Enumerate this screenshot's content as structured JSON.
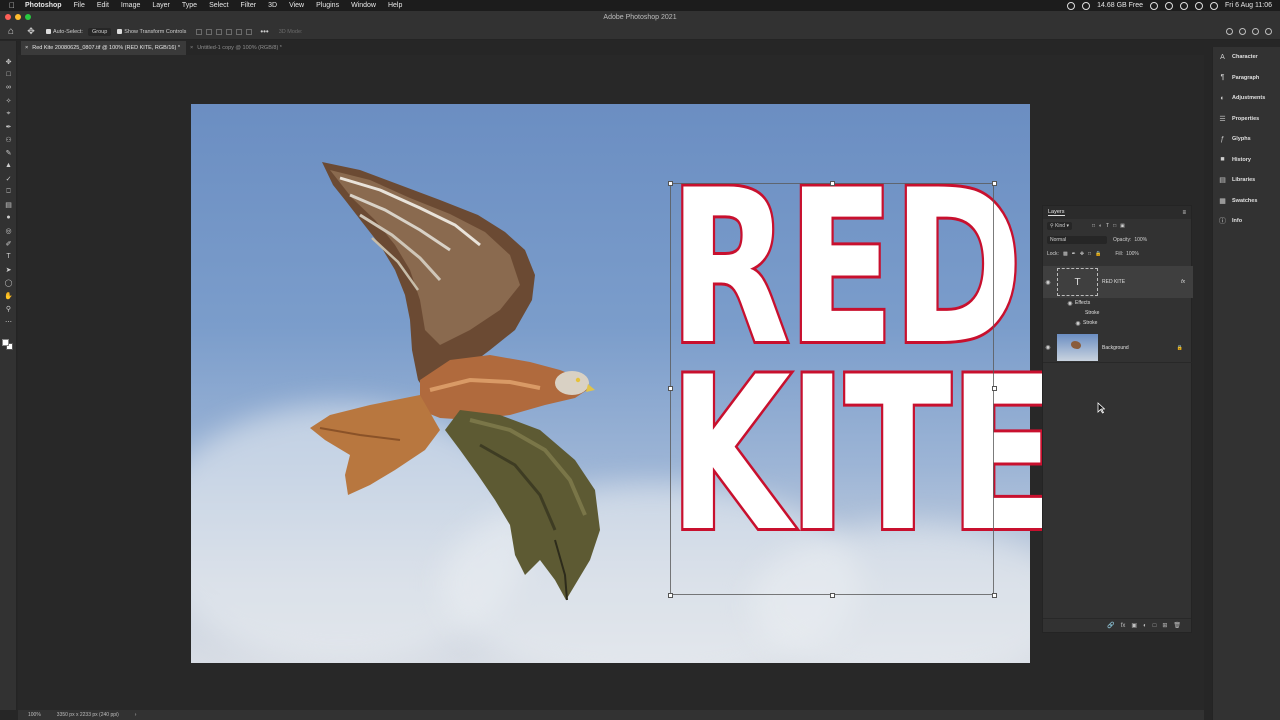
{
  "menubar": {
    "app": "Photoshop",
    "items": [
      "File",
      "Edit",
      "Image",
      "Layer",
      "Type",
      "Select",
      "Filter",
      "3D",
      "View",
      "Plugins",
      "Window",
      "Help"
    ],
    "memory": "14.68 GB Free",
    "clock": "Fri 6 Aug  11:06"
  },
  "window": {
    "title": "Adobe Photoshop 2021"
  },
  "options": {
    "auto_select": "Auto-Select:",
    "auto_select_target": "Group",
    "transform_controls": "Show Transform Controls",
    "mode_3d": "3D Mode:"
  },
  "tabs": [
    {
      "label": "Red Kite 20080625_0807.tif @ 100% (RED  KITE, RGB/16) *"
    },
    {
      "label": "Untitled-1 copy @ 100% (RGB/8) *"
    }
  ],
  "canvas": {
    "line1": "RED",
    "line2": "KITE",
    "text_fill": "#ffffff",
    "stroke_color": "#c8102e"
  },
  "right_panel": {
    "items": [
      {
        "icon": "character-icon",
        "label": "Character"
      },
      {
        "icon": "paragraph-icon",
        "label": "Paragraph"
      },
      {
        "icon": "adjustments-icon",
        "label": "Adjustments"
      },
      {
        "icon": "properties-icon",
        "label": "Properties"
      },
      {
        "icon": "glyphs-icon",
        "label": "Glyphs"
      },
      {
        "icon": "history-icon",
        "label": "History"
      },
      {
        "icon": "libraries-icon",
        "label": "Libraries"
      },
      {
        "icon": "swatches-icon",
        "label": "Swatches"
      },
      {
        "icon": "info-icon",
        "label": "Info"
      }
    ]
  },
  "layers": {
    "title": "Layers",
    "filter": "Kind",
    "blend": "Normal",
    "opacity_label": "Opacity:",
    "opacity": "100%",
    "lock_label": "Lock:",
    "fill_label": "Fill:",
    "fill": "100%",
    "text_layer": "RED  KITE",
    "effects": "Effects",
    "stroke1": "Stroke",
    "stroke2": "Stroke",
    "bg_layer": "Background"
  },
  "status": {
    "zoom": "100%",
    "doc_info": "3350 px x 2233 px (240 ppi)"
  }
}
